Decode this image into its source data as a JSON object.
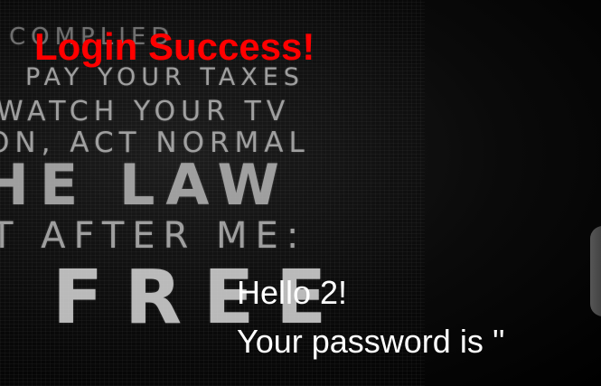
{
  "message": {
    "title": "Login Success!",
    "greeting": "Hello 2!",
    "password_line": "Your password is ''"
  },
  "background": {
    "lines": [
      "COMPLIED",
      "PAY YOUR TAXES",
      "WATCH YOUR TV",
      "ON, ACT NORMAL",
      "HE LAW",
      "T AFTER ME:",
      "FREE"
    ]
  },
  "colors": {
    "title": "#ff0000",
    "text": "#ffffff",
    "background": "#000000"
  }
}
